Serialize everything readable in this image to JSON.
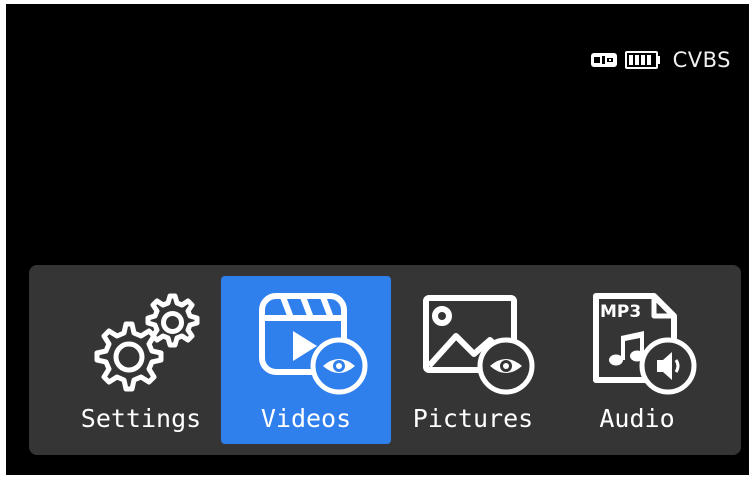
{
  "status": {
    "source_label": "CVBS",
    "usb_icon": "usb-icon",
    "battery_icon": "battery-icon",
    "battery_level": 1.0
  },
  "menu": {
    "selected_index": 1,
    "accent_color": "#2f80ed",
    "items": [
      {
        "label": "Settings",
        "icon": "gears-icon"
      },
      {
        "label": "Videos",
        "icon": "video-eye-icon"
      },
      {
        "label": "Pictures",
        "icon": "picture-eye-icon"
      },
      {
        "label": "Audio",
        "icon": "mp3-audio-icon",
        "badge": "MP3"
      }
    ]
  }
}
